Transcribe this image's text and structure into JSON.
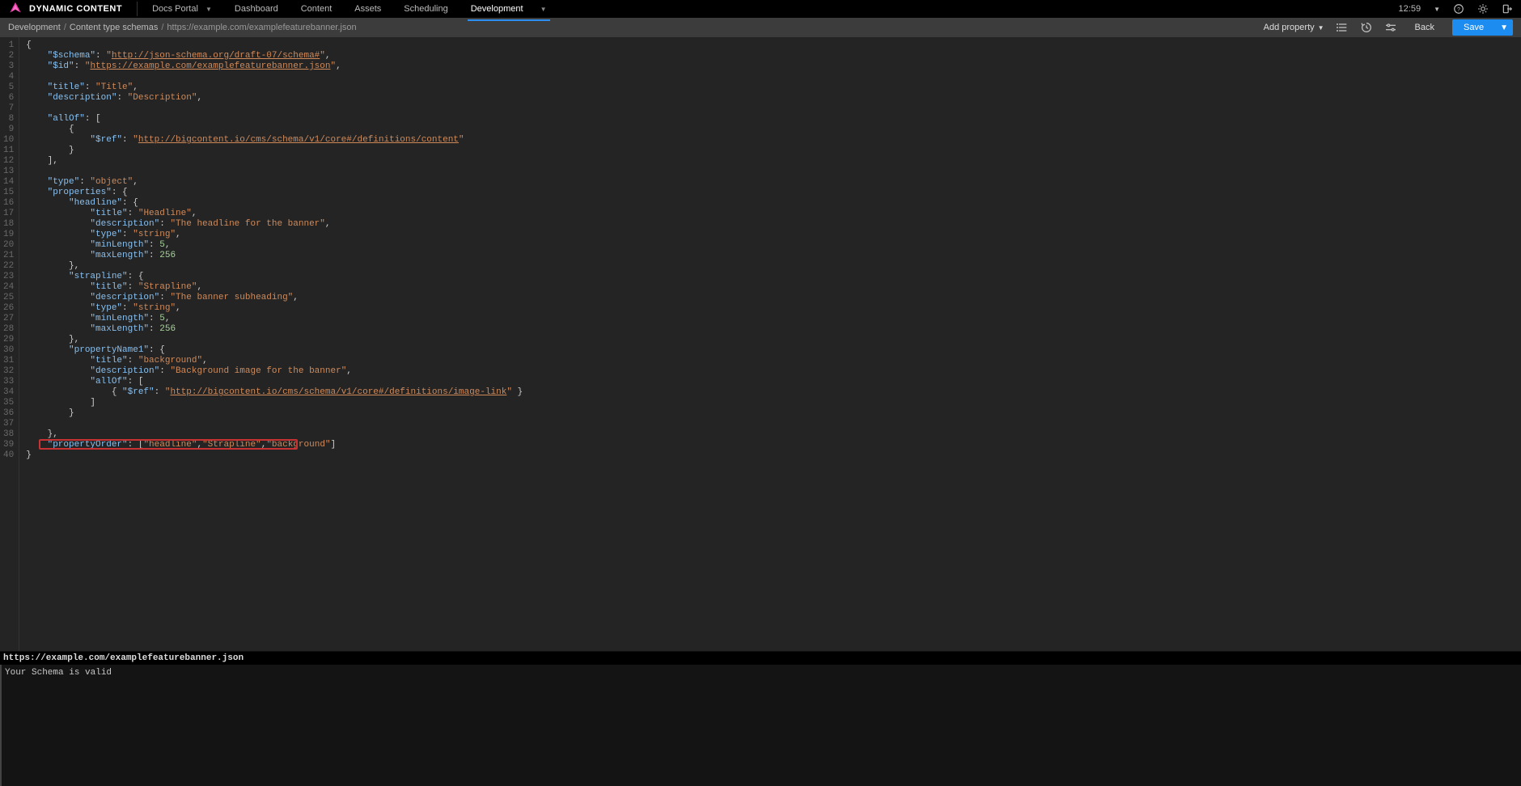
{
  "header": {
    "brand": "DYNAMIC CONTENT",
    "docs_portal": "Docs Portal",
    "nav": {
      "dashboard": "Dashboard",
      "content": "Content",
      "assets": "Assets",
      "scheduling": "Scheduling",
      "development": "Development"
    },
    "time": "12:59"
  },
  "breadcrumb": {
    "a": "Development",
    "b": "Content type schemas",
    "c": "https://example.com/examplefeaturebanner.json"
  },
  "toolbar": {
    "add_property": "Add property",
    "back": "Back",
    "save": "Save"
  },
  "validation": {
    "file": "https://example.com/examplefeaturebanner.json",
    "message": "Your Schema is valid"
  },
  "code": {
    "schema_url": "http://json-schema.org/draft-07/schema#",
    "id_url": "https://example.com/examplefeaturebanner.json",
    "title_val": "Title",
    "description_val": "Description",
    "allof_ref": "http://bigcontent.io/cms/schema/v1/core#/definitions/content",
    "type_val": "object",
    "headline": {
      "title": "Headline",
      "description": "The headline for the banner",
      "type": "string",
      "minLength": 5,
      "maxLength": 256
    },
    "strapline": {
      "title": "Strapline",
      "description": "The banner subheading",
      "type": "string",
      "minLength": 5,
      "maxLength": 256
    },
    "propertyName1": {
      "title": "background",
      "description": "Background image for the banner",
      "ref": "http://bigcontent.io/cms/schema/v1/core#/definitions/image-link"
    },
    "propertyOrder": [
      "headline",
      "Strapline",
      "background"
    ]
  }
}
